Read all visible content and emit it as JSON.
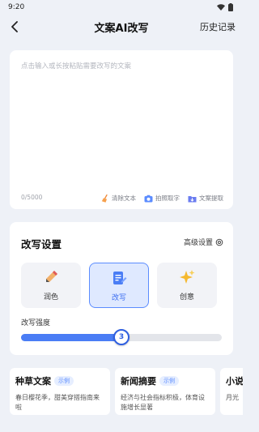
{
  "status_bar": {
    "time": "9:20"
  },
  "nav": {
    "title": "文案AI改写",
    "history": "历史记录"
  },
  "editor": {
    "placeholder": "点击输入或长按粘贴需要改写的文案",
    "count": "0/5000",
    "tools": [
      "清除文本",
      "拍照取字",
      "文案提取"
    ]
  },
  "settings": {
    "title": "改写设置",
    "advanced": "高级设置",
    "modes": [
      {
        "label": "润色",
        "icon": "pencil-icon"
      },
      {
        "label": "改写",
        "icon": "document-edit-icon"
      },
      {
        "label": "创意",
        "icon": "sparkle-icon"
      }
    ],
    "active_mode": "改写",
    "intensity_label": "改写强度",
    "intensity_value": "3",
    "intensity_fraction": 0.5
  },
  "examples": [
    {
      "title": "种草文案",
      "badge": "示例",
      "desc": "春日樱花季，甜美穿搭指南来啦"
    },
    {
      "title": "新闻摘要",
      "badge": "示例",
      "desc": "经济与社会指标积极，体育设施增长显著"
    },
    {
      "title": "小说",
      "badge": "",
      "desc": "月光"
    }
  ],
  "colors": {
    "accent": "#4a7df5",
    "background": "#eef1f7"
  }
}
